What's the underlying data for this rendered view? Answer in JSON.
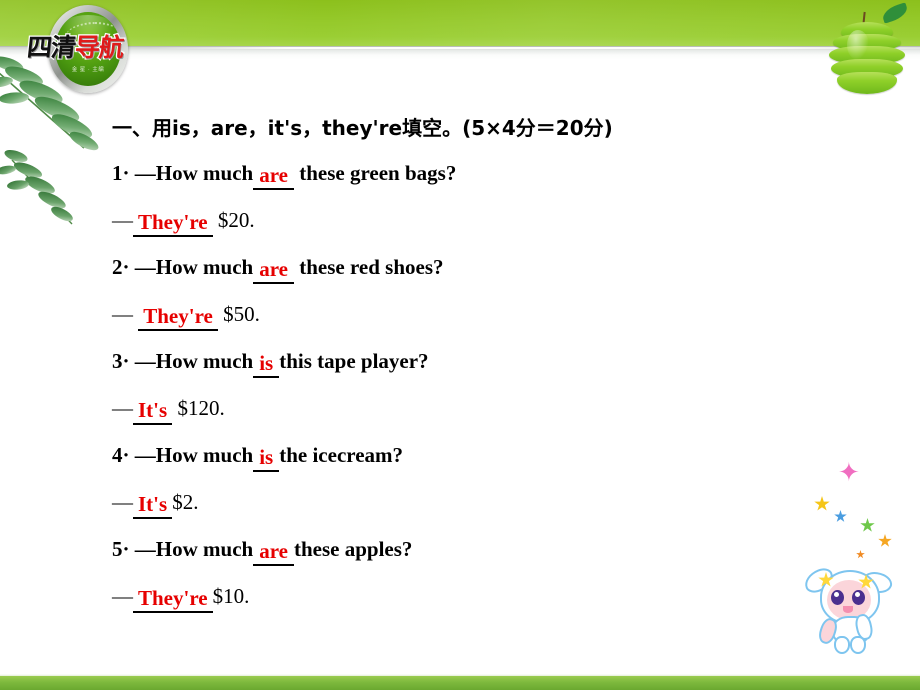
{
  "slide": {
    "logo": {
      "text_black": "四清",
      "text_red": "导航",
      "subtitle": "金 星 · 主编"
    },
    "decorations": {
      "apple_name": "sliced-green-apple",
      "leaves_name": "fern-leaves",
      "mascot_name": "cartoon-bunny-mascot",
      "sparkle_glyph": "✦"
    },
    "colors": {
      "banner_green": "#8cc01c",
      "bottom_bar_green": "#7db93d",
      "answer_red": "#e60000",
      "text_black": "#000000"
    }
  },
  "exercise": {
    "heading": {
      "marker": "一、",
      "prefix_cjk": "用",
      "words": "is，are，it's，they're",
      "suffix_cjk": "填空。",
      "score": "(5×4分＝20分)",
      "full": "一、用is，are，it's，they're填空。(5×4分＝20分)"
    },
    "items": [
      {
        "number": "1",
        "sep": "·",
        "dash": "—",
        "q_before": "How much",
        "blank": "are",
        "q_after": "these green bags?",
        "answer_dash": "—",
        "answer_blank": "They're",
        "answer_rest": "$20."
      },
      {
        "number": "2",
        "sep": "·",
        "dash": "—",
        "q_before": "How much",
        "blank": "are",
        "q_after": "these red shoes?",
        "answer_dash": "—",
        "answer_blank": "They're",
        "answer_rest": "$50."
      },
      {
        "number": "3",
        "sep": "·",
        "dash": "—",
        "q_before": "How much",
        "blank": "is",
        "q_after": "this tape player?",
        "answer_dash": "—",
        "answer_blank": "It's",
        "answer_rest": "$120."
      },
      {
        "number": "4",
        "sep": "·",
        "dash": "—",
        "q_before": "How much",
        "blank": "is",
        "q_after": "the icecream?",
        "answer_dash": "—",
        "answer_blank": "It's",
        "answer_rest": "$2."
      },
      {
        "number": "5",
        "sep": "·",
        "dash": "—",
        "q_before": "How much",
        "blank": "are",
        "q_after": "these apples?",
        "answer_dash": "—",
        "answer_blank": "They're",
        "answer_rest": "$10."
      }
    ]
  }
}
